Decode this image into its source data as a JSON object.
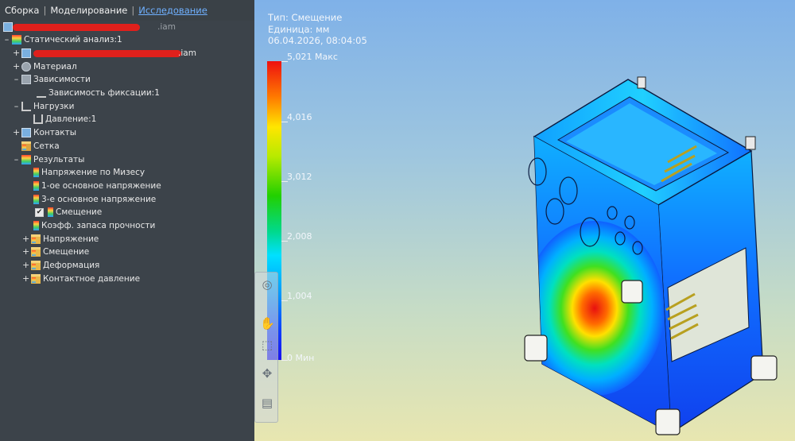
{
  "tabs": [
    "Сборка",
    "Моделирование",
    "Исследование"
  ],
  "tree": {
    "root_suffix": ".iam",
    "analysis": "Статический анализ:1",
    "model_suffix": ".iam",
    "material": "Материал",
    "constraints": "Зависимости",
    "fixed": "Зависимость фиксации:1",
    "loads": "Нагрузки",
    "pressure": "Давление:1",
    "contacts": "Контакты",
    "mesh": "Сетка",
    "results": "Результаты",
    "von_mises": "Напряжение по Мизесу",
    "first_principal": "1-ое основное напряжение",
    "third_principal": "3-е основное напряжение",
    "displacement": "Смещение",
    "safety": "Коэфф. запаса прочности",
    "f_stress": "Напряжение",
    "f_disp": "Смещение",
    "f_strain": "Деформация",
    "f_contact": "Контактное давление"
  },
  "legend": {
    "type": "Тип: Смещение",
    "unit": "Единица: мм",
    "date": "06.04.2026, 08:04:05",
    "max": "5,021 Макс",
    "v4": "4,016",
    "v3": "3,012",
    "v2": "2,008",
    "v1": "1,004",
    "min": "0 Мин"
  },
  "colors": {
    "panel_bg": "#3c434a",
    "active_tab": "#6fb0ff",
    "redaction": "#e0201c"
  }
}
